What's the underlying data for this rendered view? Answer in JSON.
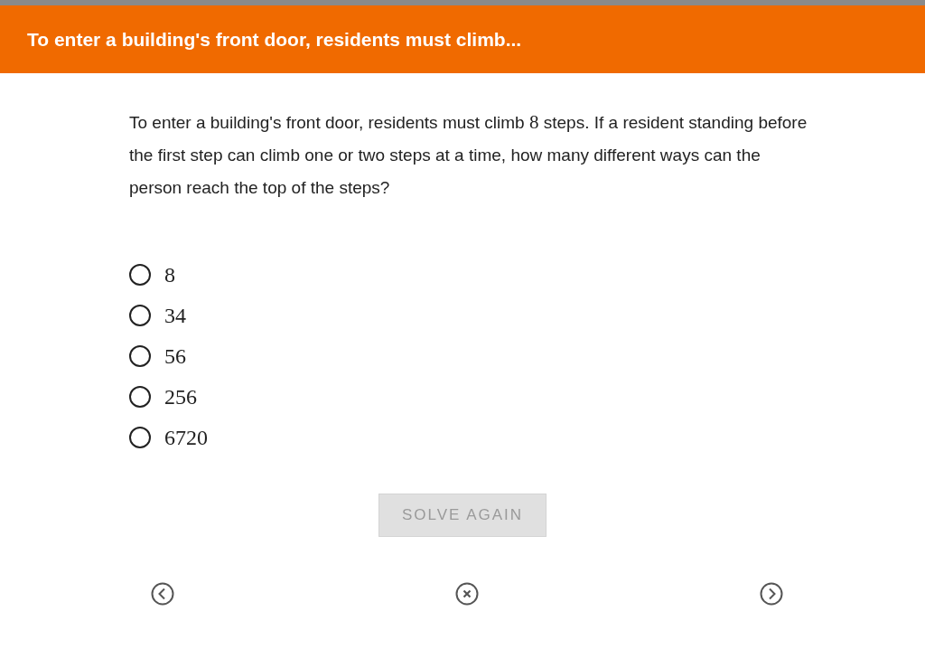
{
  "header": {
    "title": "To enter a building's front door, residents must climb..."
  },
  "question": {
    "before": "To enter a building's front door, residents must climb ",
    "math": "8",
    "after": " steps. If a resident standing before the first step can climb one or two steps at a time, how many different ways can the person reach the top of the steps?"
  },
  "options": [
    {
      "label": "8",
      "selected": false
    },
    {
      "label": "34",
      "selected": false
    },
    {
      "label": "56",
      "selected": false
    },
    {
      "label": "256",
      "selected": false
    },
    {
      "label": "6720",
      "selected": false
    }
  ],
  "solve_button": {
    "label": "SOLVE AGAIN",
    "disabled": true
  }
}
